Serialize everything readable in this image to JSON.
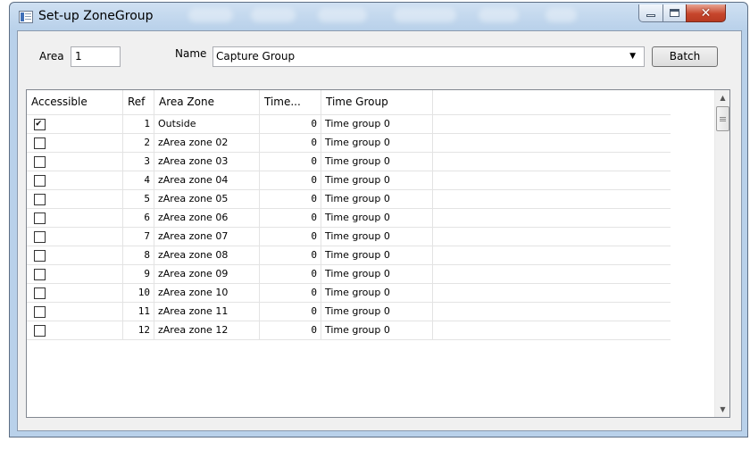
{
  "window": {
    "title": "Set-up ZoneGroup"
  },
  "form": {
    "area_label": "Area",
    "area_value": "1",
    "name_label": "Name",
    "name_value": "Capture Group",
    "batch_label": "Batch"
  },
  "grid": {
    "columns": [
      "Accessible",
      "Ref",
      "Area Zone",
      "Time...",
      "Time Group"
    ],
    "rows": [
      {
        "accessible": true,
        "ref": "1",
        "zone": "Outside",
        "time": "0",
        "group": "Time group 0"
      },
      {
        "accessible": false,
        "ref": "2",
        "zone": "zArea zone 02",
        "time": "0",
        "group": "Time group 0"
      },
      {
        "accessible": false,
        "ref": "3",
        "zone": "zArea zone 03",
        "time": "0",
        "group": "Time group 0"
      },
      {
        "accessible": false,
        "ref": "4",
        "zone": "zArea zone 04",
        "time": "0",
        "group": "Time group 0"
      },
      {
        "accessible": false,
        "ref": "5",
        "zone": "zArea zone 05",
        "time": "0",
        "group": "Time group 0"
      },
      {
        "accessible": false,
        "ref": "6",
        "zone": "zArea zone 06",
        "time": "0",
        "group": "Time group 0"
      },
      {
        "accessible": false,
        "ref": "7",
        "zone": "zArea zone 07",
        "time": "0",
        "group": "Time group 0"
      },
      {
        "accessible": false,
        "ref": "8",
        "zone": "zArea zone 08",
        "time": "0",
        "group": "Time group 0"
      },
      {
        "accessible": false,
        "ref": "9",
        "zone": "zArea zone 09",
        "time": "0",
        "group": "Time group 0"
      },
      {
        "accessible": false,
        "ref": "10",
        "zone": "zArea zone 10",
        "time": "0",
        "group": "Time group 0"
      },
      {
        "accessible": false,
        "ref": "11",
        "zone": "zArea zone 11",
        "time": "0",
        "group": "Time group 0"
      },
      {
        "accessible": false,
        "ref": "12",
        "zone": "zArea zone 12",
        "time": "0",
        "group": "Time group 0"
      }
    ]
  },
  "icons": {
    "app": "app-window-icon",
    "minimize": "minimize-icon",
    "maximize": "maximize-icon",
    "close": "close-icon",
    "dropdown": "chevron-down-icon",
    "scroll_up": "scroll-up-arrow-icon",
    "scroll_down": "scroll-down-arrow-icon",
    "checkbox_checked": "checkbox-checked-icon",
    "checkbox_unchecked": "checkbox-unchecked-icon"
  },
  "colors": {
    "title_bar": "#b9d1ea",
    "close_button": "#c7462c",
    "client_bg": "#f0f0f0",
    "grid_lines": "#e3e3e3"
  }
}
